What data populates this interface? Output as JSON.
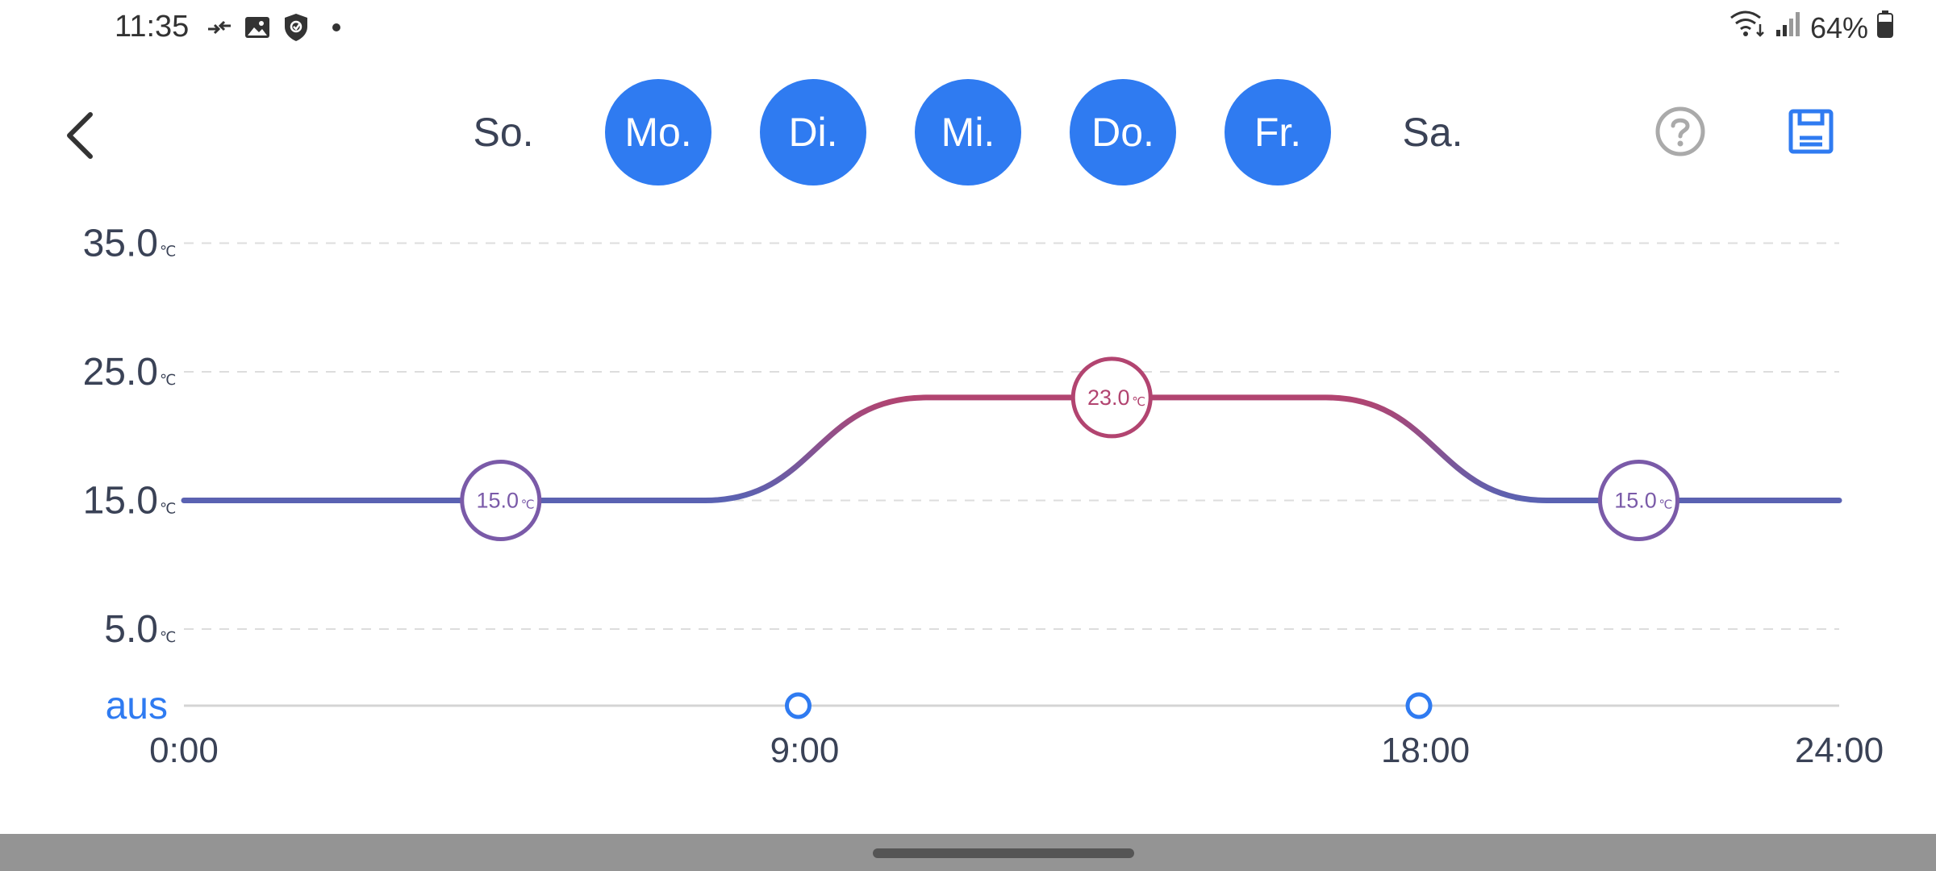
{
  "status": {
    "time": "11:35",
    "battery": "64%",
    "icons": [
      "data-transfer-icon",
      "image-icon",
      "shield-icon",
      "dot-icon",
      "wifi-icon",
      "signal-icon",
      "battery-icon"
    ]
  },
  "header": {
    "days": [
      {
        "label": "So.",
        "active": false
      },
      {
        "label": "Mo.",
        "active": true
      },
      {
        "label": "Di.",
        "active": true
      },
      {
        "label": "Mi.",
        "active": true
      },
      {
        "label": "Do.",
        "active": true
      },
      {
        "label": "Fr.",
        "active": true
      },
      {
        "label": "Sa.",
        "active": false
      }
    ],
    "icons": [
      "back-arrow-icon",
      "help-icon",
      "save-icon"
    ],
    "accent": "#2f7bf1"
  },
  "chart_data": {
    "type": "line",
    "y_ticks": [
      "35.0",
      "25.0",
      "15.0",
      "5.0"
    ],
    "y_unit": "℃",
    "off_label": "aus",
    "x_ticks": [
      "0:00",
      "9:00",
      "18:00",
      "24:00"
    ],
    "ylim": [
      0,
      35
    ],
    "xlim": [
      0,
      24
    ],
    "segments": [
      {
        "start": 0,
        "end": 9,
        "temp": 15.0,
        "label": "15.0"
      },
      {
        "start": 9,
        "end": 18,
        "temp": 23.0,
        "label": "23.0"
      },
      {
        "start": 18,
        "end": 24,
        "temp": 15.0,
        "label": "15.0"
      }
    ],
    "handles": [
      9,
      18
    ],
    "colors": {
      "low": "#5a62b2",
      "high": "#b24470",
      "off_label": "#2f7bf1"
    }
  }
}
